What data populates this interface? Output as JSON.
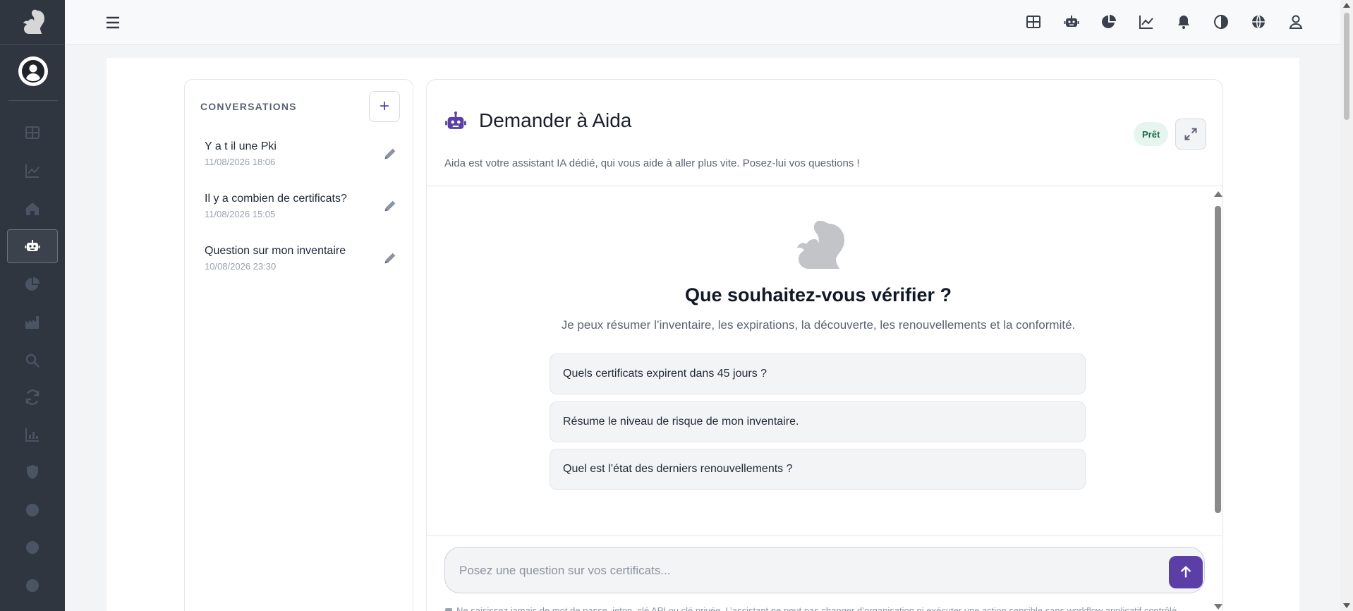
{
  "conversations": {
    "title": "CONVERSATIONS",
    "add_label": "+",
    "items": [
      {
        "title": "Y a t il une Pki",
        "date": "11/08/2026 18:06"
      },
      {
        "title": "Il y a combien de certificats?",
        "date": "11/08/2026 15:05"
      },
      {
        "title": "Question sur mon inventaire",
        "date": "10/08/2026 23:30"
      }
    ]
  },
  "chat": {
    "title": "Demander à Aida",
    "subtitle": "Aida est votre assistant IA dédié, qui vous aide à aller plus vite. Posez-lui vos questions !",
    "status": "Prêt",
    "empty_title": "Que souhaitez-vous vérifier ?",
    "empty_subtitle": "Je peux résumer l’inventaire, les expirations, la découverte, les renouvellements et la conformité.",
    "suggestions": [
      "Quels certificats expirent dans 45 jours ?",
      "Résume le niveau de risque de mon inventaire.",
      "Quel est l’état des derniers renouvellements ?"
    ],
    "input_placeholder": "Posez une question sur vos certificats...",
    "disclaimer": "Ne saisissez jamais de mot de passe, jeton, clé API ou clé privée. L’assistant ne peut pas changer d’organisation ni exécuter une action sensible sans workflow applicatif contrôlé."
  },
  "sidebar": {
    "items": [
      "dashboard-icon",
      "trend-chart-icon",
      "home-icon",
      "robot-icon",
      "pie-chart-icon",
      "factory-icon",
      "search-icon",
      "sync-icon",
      "bar-chart-icon",
      "shield-icon",
      "circle-icon",
      "circle-icon",
      "circle-icon"
    ],
    "active": "robot-icon"
  },
  "topbar": {
    "icons": [
      "dashboard-icon",
      "robot-icon",
      "pie-chart-icon",
      "trend-chart-icon",
      "bell-icon",
      "contrast-icon",
      "globe-icon",
      "user-icon"
    ]
  },
  "colors": {
    "sidebar_bg": "#2f3640",
    "accent": "#5b3fa6",
    "status_bg": "#e6f6ee",
    "status_text": "#1c6b44"
  }
}
